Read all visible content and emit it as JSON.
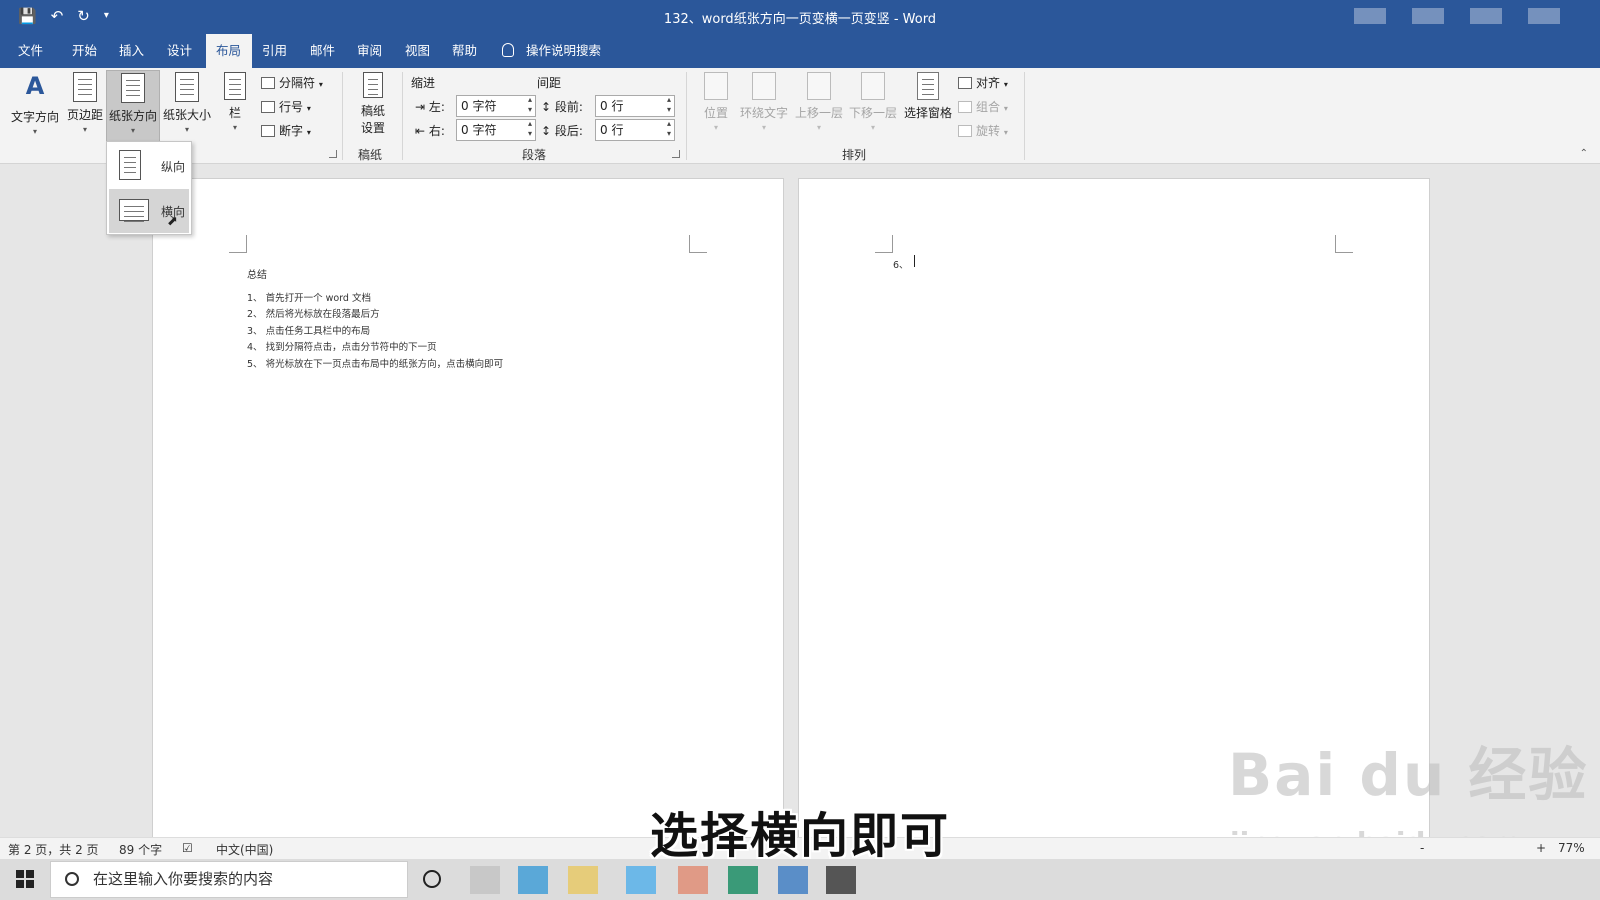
{
  "window": {
    "title": "132、word纸张方向一页变横一页变竖 - Word"
  },
  "qat": {
    "save_icon": "save-icon",
    "undo_icon": "undo-icon",
    "redo_icon": "redo-icon",
    "customize_icon": "customize-icon"
  },
  "tabs": [
    {
      "label": "文件"
    },
    {
      "label": "开始"
    },
    {
      "label": "插入"
    },
    {
      "label": "设计"
    },
    {
      "label": "布局"
    },
    {
      "label": "引用"
    },
    {
      "label": "邮件"
    },
    {
      "label": "审阅"
    },
    {
      "label": "视图"
    },
    {
      "label": "帮助"
    }
  ],
  "tellme": "操作说明搜索",
  "ribbon": {
    "page_setup": {
      "text_direction": "文字方向",
      "margins": "页边距",
      "orientation": "纸张方向",
      "size": "纸张大小",
      "columns": "栏",
      "breaks": "分隔符",
      "line_numbers": "行号",
      "hyphenation": "断字"
    },
    "manuscript": {
      "button": "稿纸\n设置",
      "button_line1": "稿纸",
      "button_line2": "设置",
      "label": "稿纸"
    },
    "paragraph": {
      "indent_header": "缩进",
      "spacing_header": "间距",
      "left_label": "左:",
      "left_value": "0 字符",
      "right_label": "右:",
      "right_value": "0 字符",
      "before_label": "段前:",
      "before_value": "0 行",
      "after_label": "段后:",
      "after_value": "0 行",
      "label": "段落"
    },
    "arrange": {
      "position": "位置",
      "wrap_text": "环绕文字",
      "bring_forward": "上移一层",
      "send_backward": "下移一层",
      "selection_pane": "选择窗格",
      "align": "对齐",
      "group": "组合",
      "rotate": "旋转",
      "label": "排列"
    }
  },
  "orientation_menu": {
    "portrait": "纵向",
    "landscape": "横向"
  },
  "document": {
    "page1": {
      "heading": "总结",
      "lines": [
        "1、 首先打开一个 word 文档",
        "2、 然后将光标放在段落最后方",
        "3、 点击任务工具栏中的布局",
        "4、 找到分隔符点击，点击分节符中的下一页",
        "5、 将光标放在下一页点击布局中的纸张方向，点击横向即可"
      ]
    },
    "page2": {
      "line": "6、"
    }
  },
  "statusbar": {
    "page_info": "第 2 页，共 2 页",
    "word_count": "89 个字",
    "language": "中文(中国)",
    "zoom": "77%",
    "zoom_minus": "-",
    "zoom_plus": "+"
  },
  "subtitle": "选择横向即可",
  "watermark": {
    "brand": "Bai du 经验",
    "url": "jingyan.baidu.com"
  },
  "taskbar": {
    "search_placeholder": "在这里输入你要搜索的内容"
  }
}
